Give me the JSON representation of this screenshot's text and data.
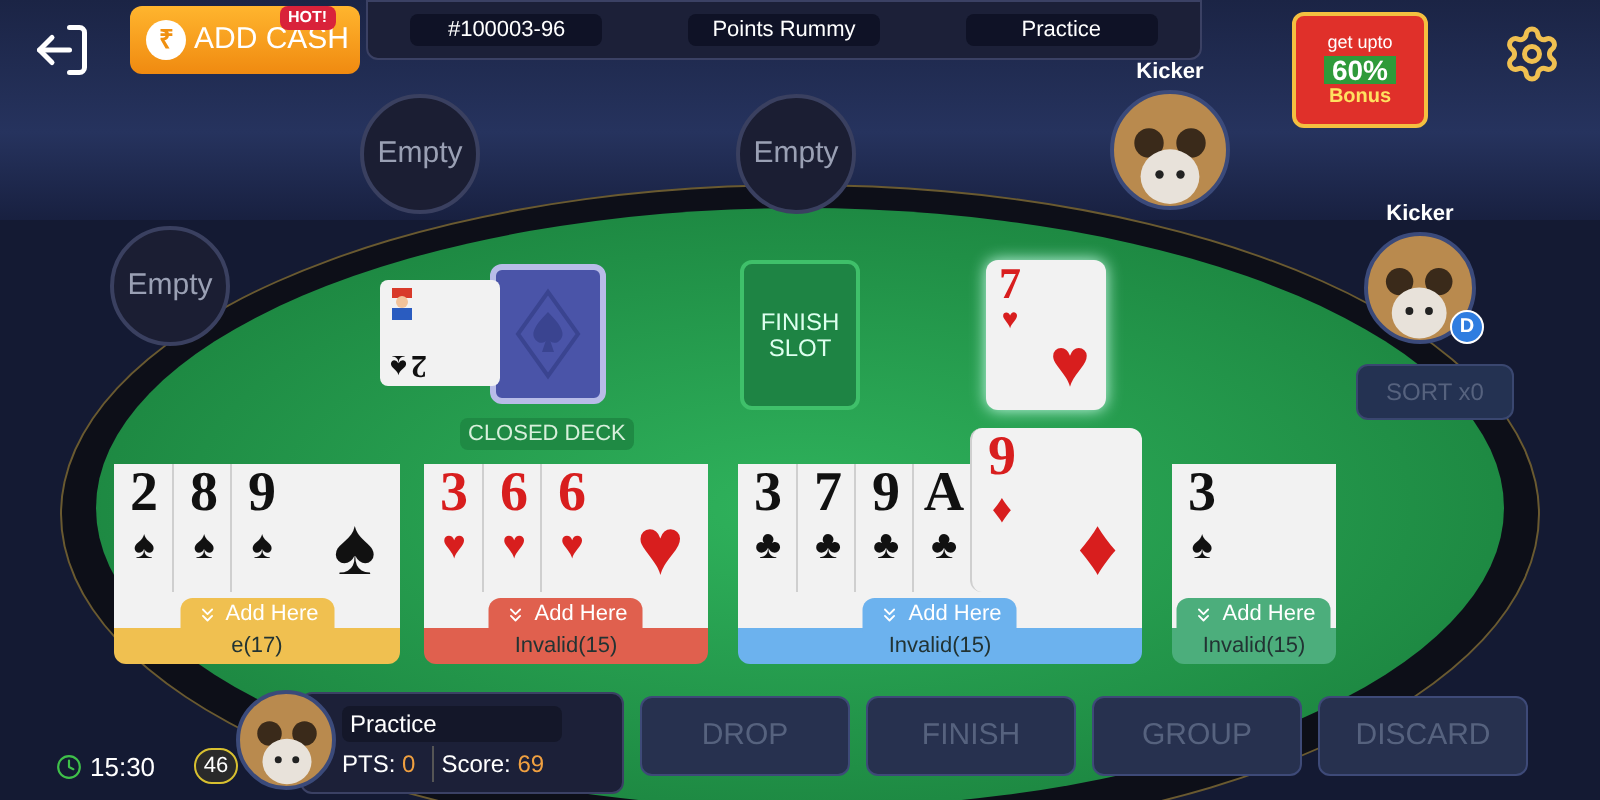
{
  "top_bar": {
    "game_id": "#100003-96",
    "game_type": "Points Rummy",
    "mode": "Practice"
  },
  "add_cash": {
    "currency": "₹",
    "label": "ADD CASH",
    "badge": "HOT!"
  },
  "bonus": {
    "line_1": "get upto",
    "line_2": "60%",
    "line_3": "Bonus"
  },
  "seats": [
    {
      "kind": "empty",
      "label": "Empty"
    },
    {
      "kind": "empty",
      "label": "Empty"
    },
    {
      "kind": "player",
      "name": "Kicker",
      "dealer": false
    },
    {
      "kind": "empty",
      "label": "Empty"
    },
    {
      "kind": "player",
      "name": "Kicker",
      "dealer": true,
      "dealer_mark": "D"
    }
  ],
  "table": {
    "open_card": {
      "rank": "2",
      "suit": "♠",
      "color": "#111111"
    },
    "closed_deck_label": "CLOSED DECK",
    "finish_slot": "FINISH SLOT",
    "discard_card": {
      "rank": "7",
      "suit": "♥",
      "center_suit": "♥",
      "color": "#d81e1e"
    }
  },
  "sort_button": {
    "label": "SORT x0",
    "disabled": true
  },
  "groups": [
    {
      "color": "#f0c050",
      "add_label": "Add Here",
      "status": "e(17)",
      "cards": [
        {
          "rank": "2",
          "suit": "♠",
          "color": "#111111",
          "selected": false
        },
        {
          "rank": "8",
          "suit": "♠",
          "color": "#111111",
          "selected": false
        },
        {
          "rank": "9",
          "suit": "♠",
          "color": "#111111",
          "selected": false,
          "center_suit": "♠"
        }
      ]
    },
    {
      "color": "#e0604e",
      "add_label": "Add Here",
      "status": "Invalid(15)",
      "cards": [
        {
          "rank": "3",
          "suit": "♥",
          "color": "#d81e1e",
          "selected": false
        },
        {
          "rank": "6",
          "suit": "♥",
          "color": "#d81e1e",
          "selected": false
        },
        {
          "rank": "6",
          "suit": "♥",
          "color": "#d81e1e",
          "selected": false,
          "center_suit": "♥"
        }
      ]
    },
    {
      "color": "#6cb2ee",
      "add_label": "Add Here",
      "status": "Invalid(15)",
      "cards": [
        {
          "rank": "3",
          "suit": "♣",
          "color": "#111111",
          "selected": false
        },
        {
          "rank": "7",
          "suit": "♣",
          "color": "#111111",
          "selected": false
        },
        {
          "rank": "9",
          "suit": "♣",
          "color": "#111111",
          "selected": false
        },
        {
          "rank": "A",
          "suit": "♣",
          "color": "#111111",
          "selected": false
        },
        {
          "rank": "9",
          "suit": "♦",
          "color": "#d81e1e",
          "selected": true,
          "center_suit": "♦"
        }
      ]
    },
    {
      "color": "#4cae7c",
      "add_label": "Add Here",
      "status": "Invalid(15)",
      "cards": [
        {
          "rank": "3",
          "suit": "♠",
          "color": "#111111",
          "selected": false
        }
      ]
    }
  ],
  "player": {
    "name": "Practice",
    "pts_label": "PTS:",
    "pts": "0",
    "score_label": "Score:",
    "score": "69",
    "time": "15:30",
    "level": "46"
  },
  "actions": [
    {
      "label": "DROP",
      "disabled": true
    },
    {
      "label": "FINISH",
      "disabled": true
    },
    {
      "label": "GROUP",
      "disabled": true
    },
    {
      "label": "DISCARD",
      "disabled": true
    }
  ]
}
